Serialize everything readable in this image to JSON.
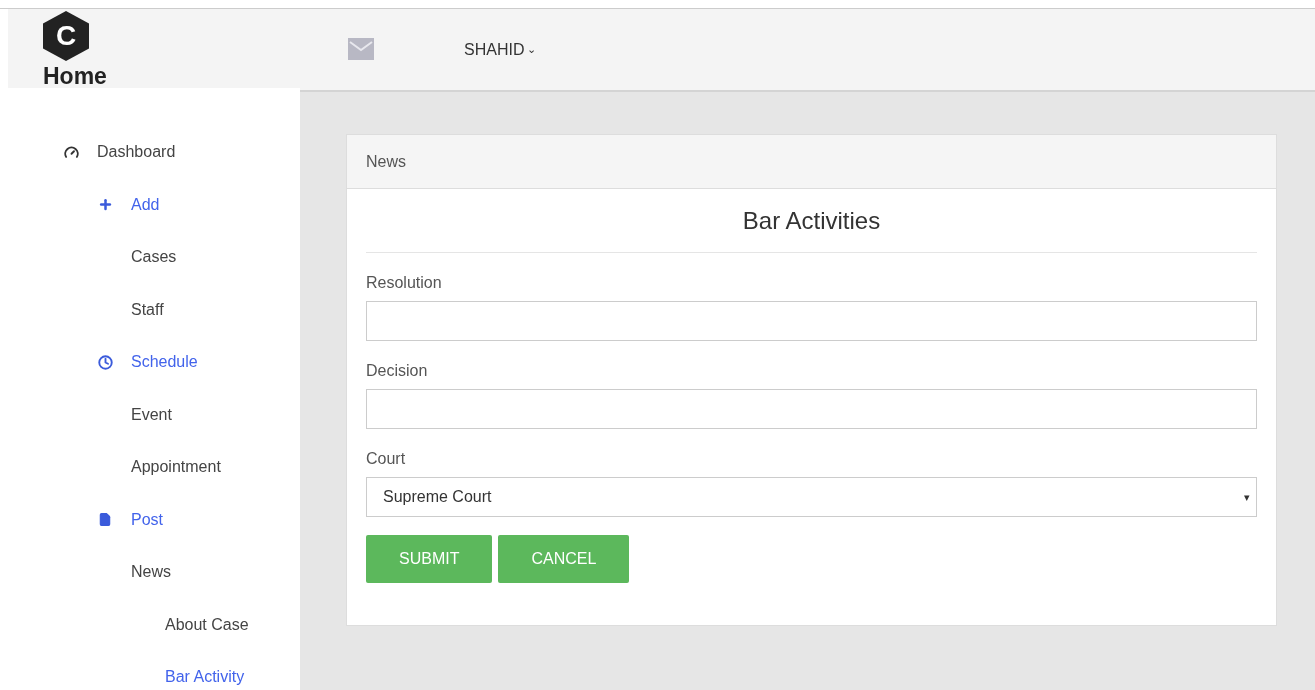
{
  "brand": {
    "logo_letter": "C",
    "title": "Home"
  },
  "header": {
    "user": "SHAHID",
    "user_caret": "⌄"
  },
  "sidebar": {
    "items": [
      {
        "label": "Dashboard",
        "kind": "top",
        "children": [
          {
            "label": "Add",
            "kind": "group",
            "children": [
              {
                "label": "Cases",
                "selected": false
              },
              {
                "label": "Staff",
                "selected": false
              }
            ]
          },
          {
            "label": "Schedule",
            "kind": "group",
            "children": [
              {
                "label": "Event",
                "selected": false
              },
              {
                "label": "Appointment",
                "selected": false
              }
            ]
          },
          {
            "label": "Post",
            "kind": "group",
            "children": [
              {
                "label": "News",
                "selected": false,
                "children": [
                  {
                    "label": "About Case",
                    "selected": false
                  },
                  {
                    "label": "Bar Activity",
                    "selected": true
                  }
                ]
              }
            ]
          }
        ]
      }
    ]
  },
  "panel": {
    "heading": "News",
    "title": "Bar Activities",
    "fields": [
      {
        "label": "Resolution",
        "kind": "text"
      },
      {
        "label": "Decision",
        "kind": "text"
      },
      {
        "label": "Court",
        "kind": "select",
        "value": "Supreme Court",
        "caret": "▾"
      }
    ],
    "buttons": [
      "SUBMIT",
      "CANCEL"
    ]
  }
}
